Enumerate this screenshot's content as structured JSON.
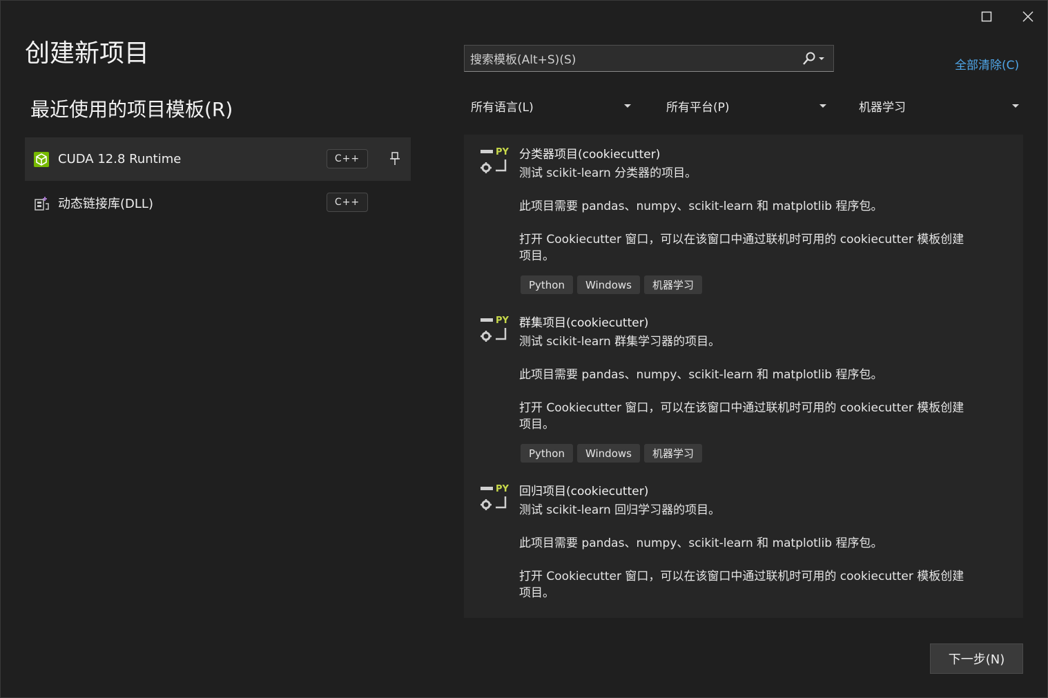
{
  "window": {
    "title": "创建新项目"
  },
  "recent": {
    "heading": "最近使用的项目模板(R)",
    "items": [
      {
        "label": "CUDA 12.8 Runtime",
        "lang": "C++",
        "icon": "cuda-icon",
        "pinned_visible": true
      },
      {
        "label": "动态链接库(DLL)",
        "lang": "C++",
        "icon": "dll-icon",
        "pinned_visible": false
      }
    ]
  },
  "search": {
    "placeholder": "搜索模板(Alt+S)(S)",
    "icon": "search-icon"
  },
  "clear_all": "全部清除(C)",
  "filters": {
    "language": "所有语言(L)",
    "platform": "所有平台(P)",
    "project_type": "机器学习"
  },
  "templates": [
    {
      "title": "分类器项目(cookiecutter)",
      "desc": "测试 scikit-learn 分类器的项目。",
      "req": "此项目需要 pandas、numpy、scikit-learn 和 matplotlib 程序包。",
      "open1": "打开 Cookiecutter 窗口，可以在该窗口中通过联机时可用的 cookiecutter 模板创建",
      "open2": "项目。",
      "tags": [
        "Python",
        "Windows",
        "机器学习"
      ]
    },
    {
      "title": "群集项目(cookiecutter)",
      "desc": "测试 scikit-learn 群集学习器的项目。",
      "req": "此项目需要 pandas、numpy、scikit-learn 和 matplotlib 程序包。",
      "open1": "打开 Cookiecutter 窗口，可以在该窗口中通过联机时可用的 cookiecutter 模板创建",
      "open2": "项目。",
      "tags": [
        "Python",
        "Windows",
        "机器学习"
      ]
    },
    {
      "title": "回归项目(cookiecutter)",
      "desc": "测试 scikit-learn 回归学习器的项目。",
      "req": "此项目需要 pandas、numpy、scikit-learn 和 matplotlib 程序包。",
      "open1": "打开 Cookiecutter 窗口，可以在该窗口中通过联机时可用的 cookiecutter 模板创建",
      "open2": "项目。",
      "tags": []
    }
  ],
  "icon_badge": "PY",
  "next_button": "下一步(N)",
  "colors": {
    "background": "#1f1f1f",
    "panel": "#262626",
    "link": "#4fa6e8",
    "py_badge": "#c8d94a"
  }
}
